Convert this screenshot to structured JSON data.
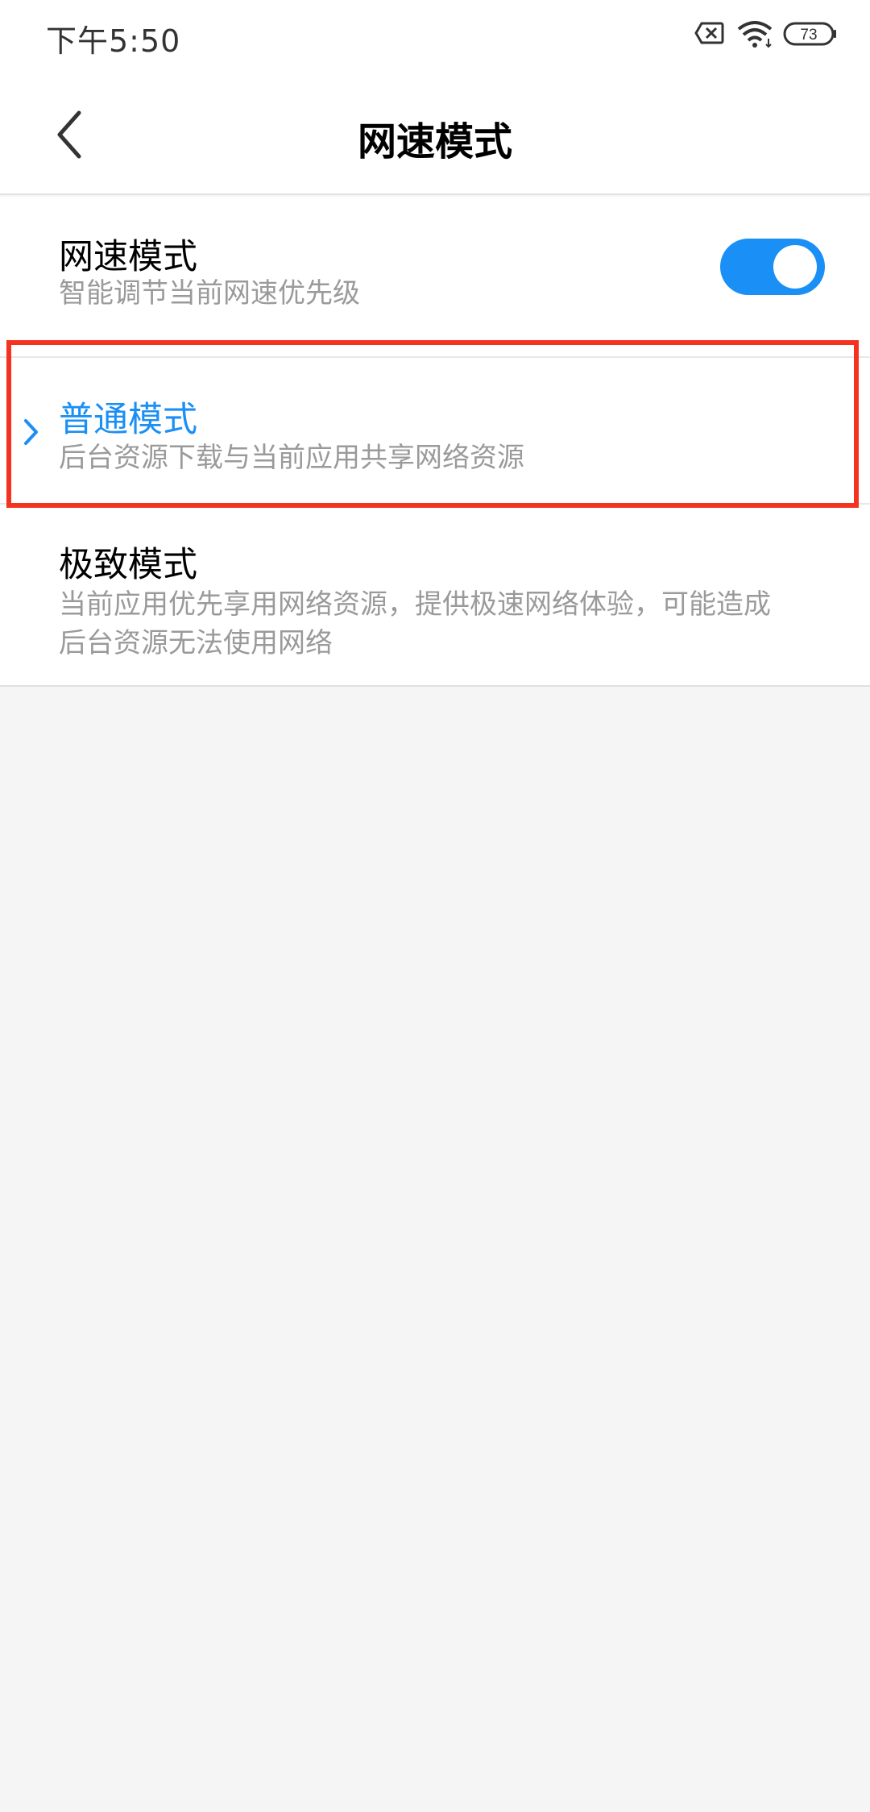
{
  "status_bar": {
    "time": "下午5:50",
    "battery": "73",
    "icons": [
      "sim-no-service-icon",
      "wifi-icon",
      "battery-icon"
    ]
  },
  "header": {
    "title": "网速模式",
    "back_icon": "chevron-left-icon"
  },
  "settings": {
    "speed_mode": {
      "title": "网速模式",
      "description": "智能调节当前网速优先级",
      "enabled": true
    },
    "normal_mode": {
      "title": "普通模式",
      "description": "后台资源下载与当前应用共享网络资源",
      "selected": true
    },
    "extreme_mode": {
      "title": "极致模式",
      "description": "当前应用优先享用网络资源，提供极速网络体验，可能造成后台资源无法使用网络",
      "selected": false
    }
  },
  "colors": {
    "accent": "#1a8ff5",
    "highlight": "#f4321f",
    "background": "#f5f5f5"
  }
}
